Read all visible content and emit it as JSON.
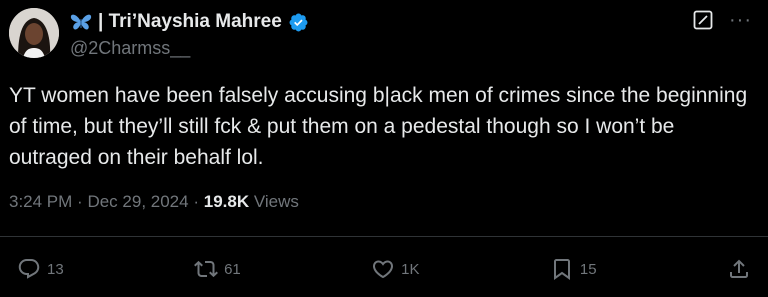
{
  "author": {
    "display_name": "| Tri’Nayshia Mahree",
    "handle": "@2Charmss__",
    "name_emoji_icon": "butterfly-icon",
    "verified_icon": "verified-badge-icon",
    "verified_color": "#1d9bf0"
  },
  "tweet": {
    "text": "YT women have been falsely accusing b|ack men of crimes since the beginning of time, but they’ll still fck & put them on a pedestal though so I won’t be outraged on their behalf lol.",
    "time": "3:24 PM",
    "date": "Dec 29, 2024",
    "separator": "·",
    "views_count": "19.8K",
    "views_label": "Views"
  },
  "actions": {
    "replies": "13",
    "reposts": "61",
    "likes": "1K",
    "bookmarks": "15"
  },
  "colors": {
    "background": "#000000",
    "text": "#e7e9ea",
    "muted": "#71767b",
    "divider": "#2f3336"
  }
}
